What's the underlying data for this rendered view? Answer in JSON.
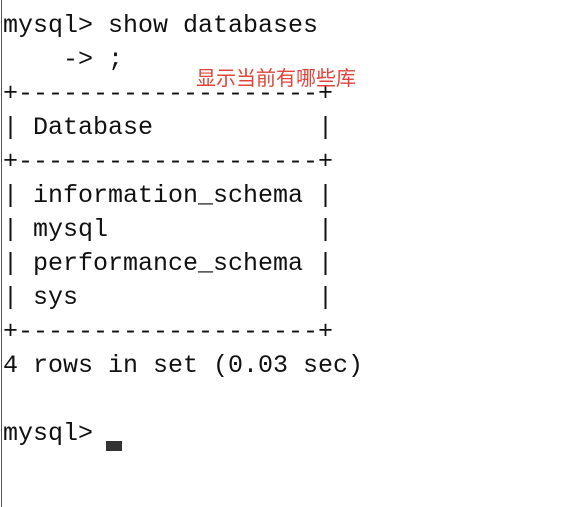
{
  "terminal": {
    "prompt_1": "mysql> show databases",
    "continuation": "    -> ;",
    "border_top": "+--------------------+",
    "header": "| Database           |",
    "border_mid": "+--------------------+",
    "rows": [
      "| information_schema |",
      "| mysql              |",
      "| performance_schema |",
      "| sys                |"
    ],
    "border_bottom": "+--------------------+",
    "result_summary": "4 rows in set (0.03 sec)",
    "blank": "",
    "prompt_2": "mysql> "
  },
  "annotation": {
    "text": "显示当前有哪些库",
    "color": "#e0443a"
  },
  "colors": {
    "text": "#111111",
    "background": "#ffffff",
    "cursor": "#333333"
  }
}
